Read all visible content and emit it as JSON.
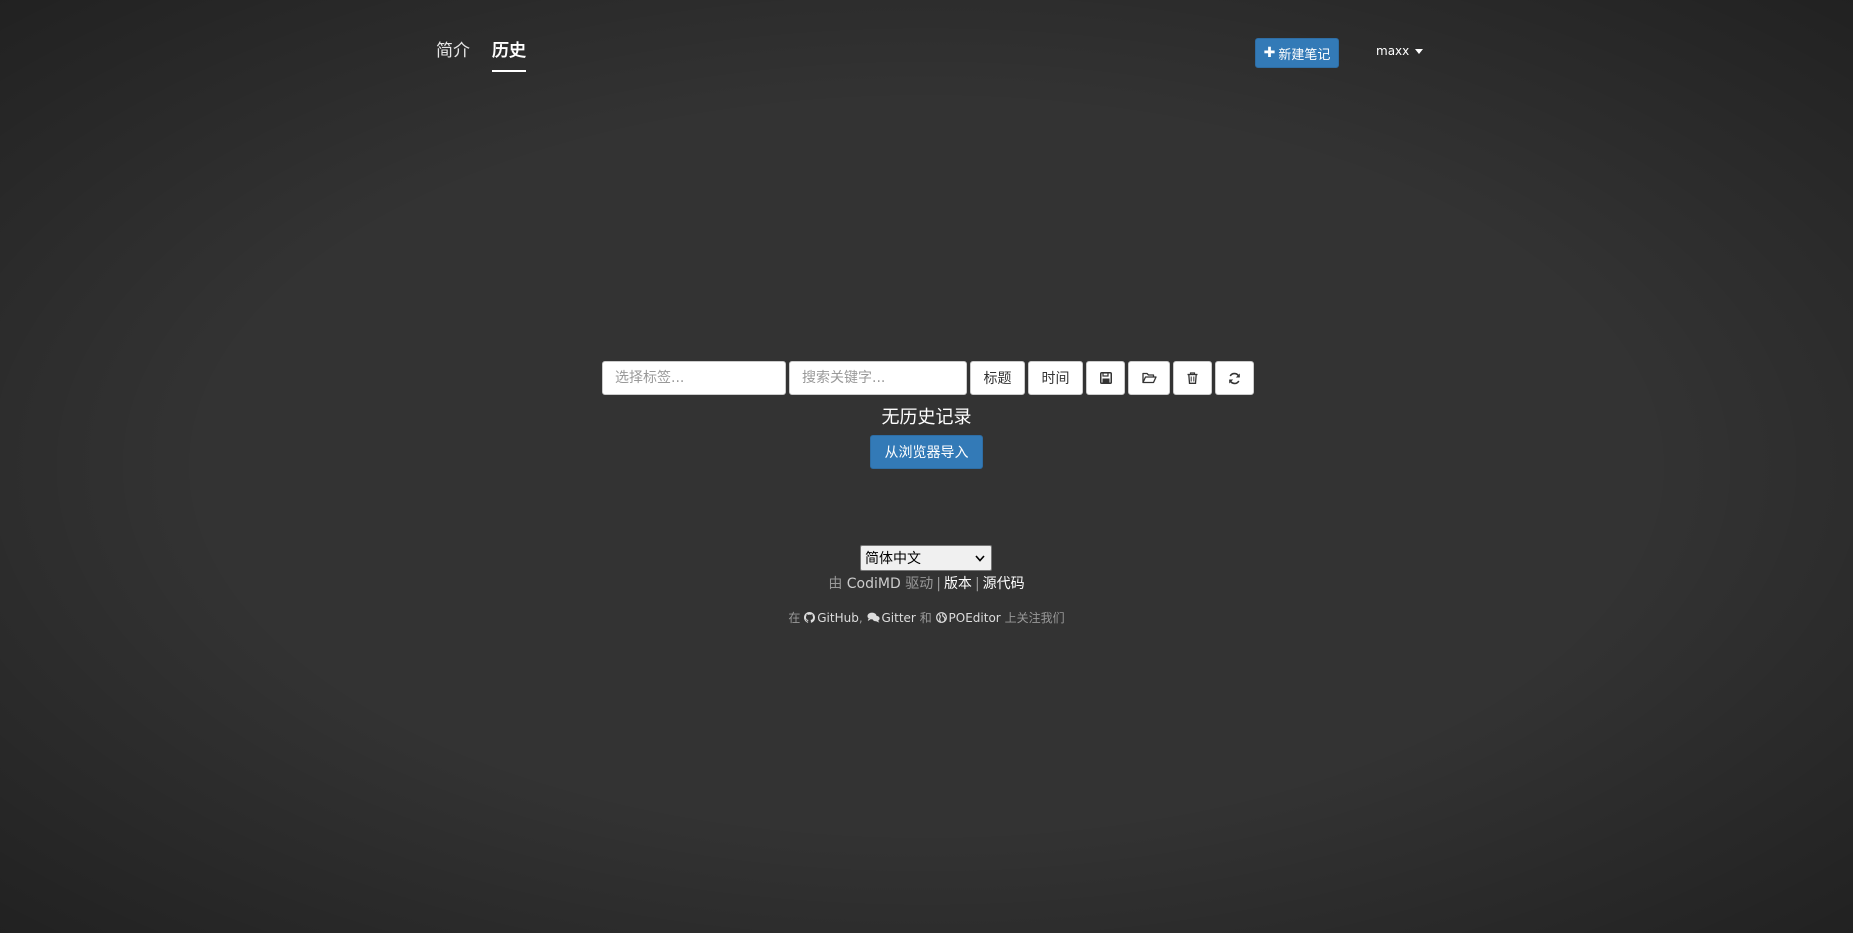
{
  "header": {
    "tabs": [
      {
        "label": "简介",
        "active": false
      },
      {
        "label": "历史",
        "active": true
      }
    ],
    "new_note_label": "新建笔记",
    "user_name": "maxx"
  },
  "toolbar": {
    "tag_placeholder": "选择标签...",
    "keyword_placeholder": "搜索关键字...",
    "sort_title_label": "标题",
    "sort_time_label": "时间",
    "icons": [
      "save-icon",
      "folder-open-icon",
      "trash-icon",
      "refresh-icon"
    ]
  },
  "history": {
    "empty_text": "无历史记录",
    "import_label": "从浏览器导入"
  },
  "footer": {
    "language": "简体中文",
    "powered_prefix": "由",
    "powered_app": "CodiMD",
    "powered_suffix": "驱动",
    "separator": "|",
    "version_label": "版本",
    "source_label": "源代码",
    "follow_prefix": "在",
    "github_label": "GitHub",
    "comma": ",",
    "gitter_label": "Gitter",
    "and_text": "和",
    "poeditor_label": "POEditor",
    "follow_suffix": "上关注我们"
  },
  "colors": {
    "background": "#333333",
    "primary": "#337ab7"
  }
}
